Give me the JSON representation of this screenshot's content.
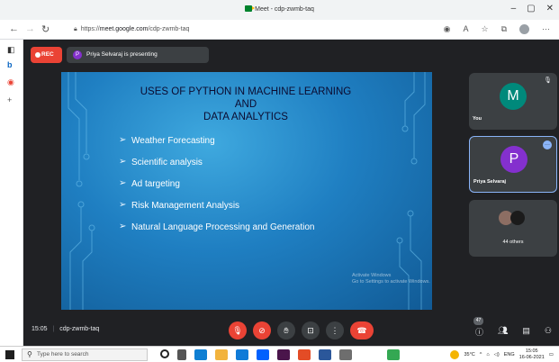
{
  "browser": {
    "tab_title": "Meet - cdp-zwmb-taq",
    "url_prefix": "https://",
    "url_host": "meet.google.com",
    "url_path": "/cdp-zwmb-taq",
    "window_controls": [
      "–",
      "▢",
      "✕"
    ]
  },
  "meet": {
    "rec_label": "REC",
    "presenter_initial": "P",
    "presenting_text": "Priya Selvaraj is presenting",
    "meeting_time": "15:05",
    "meeting_code": "cdp-zwmb-taq",
    "participant_count_badge": "47",
    "accent_color": "#8ab4f8",
    "rec_color": "#ea4335"
  },
  "slide": {
    "title_line1": "USES OF PYTHON IN MACHINE LEARNING",
    "title_line2": "AND",
    "title_line3": "DATA ANALYTICS",
    "bullets": [
      "Weather Forecasting",
      "Scientific analysis",
      "Ad targeting",
      "Risk Management Analysis",
      "Natural Language Processing and Generation"
    ],
    "watermark_line1": "Activate Windows",
    "watermark_line2": "Go to Settings to activate Windows."
  },
  "participants": [
    {
      "initial": "M",
      "name": "You",
      "color": "#00897b"
    },
    {
      "initial": "P",
      "name": "Priya Selvaraj",
      "color": "#8430ce"
    },
    {
      "name": "44 others"
    }
  ],
  "taskbar": {
    "search_placeholder": "Type here to search",
    "temperature": "35°C",
    "language": "ENG",
    "clock_time": "15:05",
    "clock_date": "16-06-2021"
  }
}
